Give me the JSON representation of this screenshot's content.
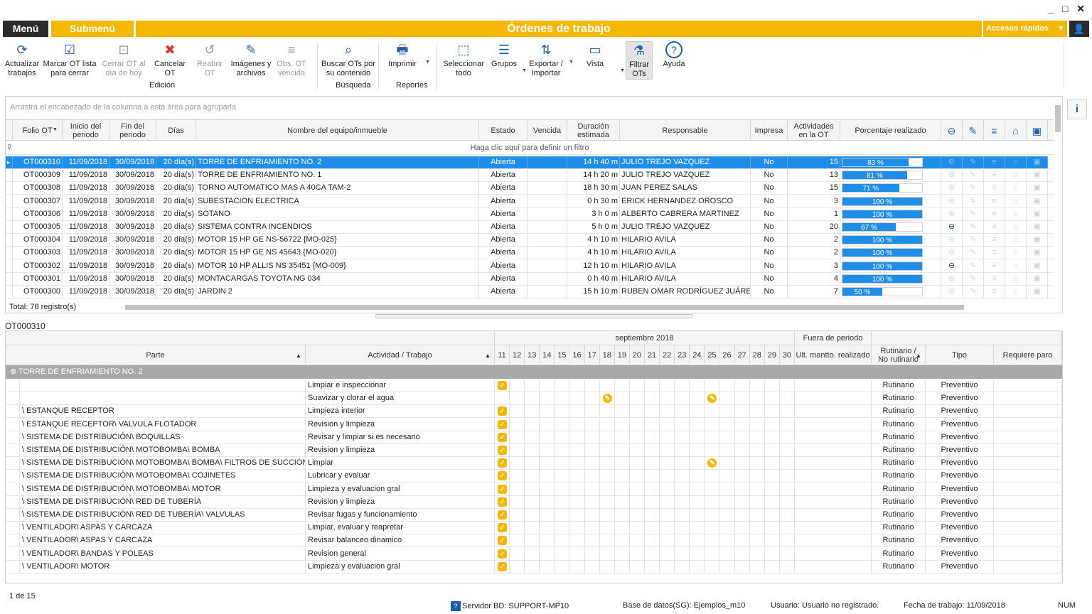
{
  "window": {
    "controls": "_ □ ✕"
  },
  "top": {
    "menu": "Menú",
    "submenu": "Submenú",
    "title": "Órdenes de trabajo",
    "quick": "Accesos rápidos"
  },
  "ribbon": {
    "buttons": [
      {
        "label": "Actualizar\ntrabajos",
        "icon": "refresh-ot-icon"
      },
      {
        "label": "Marcar OT lista\npara cerrar",
        "icon": "mark-ot-icon"
      },
      {
        "label": "Cerrar OT al\ndía de hoy",
        "icon": "close-ot-icon"
      },
      {
        "label": "Cancelar\nOT",
        "icon": "cancel-ot-icon"
      },
      {
        "label": "Reabrir\nOT",
        "icon": "reopen-ot-icon"
      },
      {
        "label": "Imágenes y\narchivos",
        "icon": "images-icon"
      },
      {
        "label": "Obs. OT\nvencida",
        "icon": "obs-icon"
      },
      {
        "label": "Buscar OTs por\nsu contenido",
        "icon": "search-ot-icon"
      },
      {
        "label": "Imprimir",
        "icon": "print-icon"
      },
      {
        "label": "Seleccionar\ntodo",
        "icon": "select-all-icon"
      },
      {
        "label": "Grupos",
        "icon": "groups-icon"
      },
      {
        "label": "Exportar /\nImportar",
        "icon": "export-icon"
      },
      {
        "label": "Vista",
        "icon": "view-icon"
      },
      {
        "label": "Filtrar\nOTs",
        "icon": "filter-icon"
      },
      {
        "label": "Ayuda",
        "icon": "help-icon"
      }
    ],
    "groups": {
      "edicion": "Edición",
      "busqueda": "Búsqueda",
      "reportes": "Reportes"
    }
  },
  "grid1": {
    "group_hint": "Arrastra el encabezado de la columna a esta área para agruparla",
    "filter_hint": "Haga clic aquí para definir un filtro",
    "columns": [
      "Folio OT",
      "Inicio del\nperiodo",
      "Fin del\nperiodo",
      "Días",
      "Nombre del equipo/inmueble",
      "Estado",
      "Vencida",
      "Duración\nestimada",
      "Responsable",
      "Impresa",
      "Actividades\nen la OT",
      "Porcentaje realizado"
    ],
    "rows": [
      {
        "folio": "OT000310",
        "inicio": "11/09/2018",
        "fin": "30/09/2018",
        "dias": "20 día(s)",
        "nombre": "TORRE DE ENFRIAMIENTO NO. 2",
        "estado": "Abierta",
        "vencida": "",
        "duracion": "14 h 40 m",
        "resp": "JULIO TREJO VAZQUEZ",
        "impresa": "No",
        "act": "15",
        "pct": 83,
        "pct_label": "83 %",
        "minus": false
      },
      {
        "folio": "OT000309",
        "inicio": "11/09/2018",
        "fin": "30/09/2018",
        "dias": "20 día(s)",
        "nombre": "TORRE DE ENFRIAMIENTO NO. 1",
        "estado": "Abierta",
        "vencida": "",
        "duracion": "14 h 20 m",
        "resp": "JULIO TREJO VAZQUEZ",
        "impresa": "No",
        "act": "13",
        "pct": 81,
        "pct_label": "81 %",
        "minus": false
      },
      {
        "folio": "OT000308",
        "inicio": "11/09/2018",
        "fin": "30/09/2018",
        "dias": "20 día(s)",
        "nombre": "TORNO AUTOMATICO MAS A 40CA TAM-2",
        "estado": "Abierta",
        "vencida": "",
        "duracion": "18 h 30 m",
        "resp": "JUAN PEREZ SALAS",
        "impresa": "No",
        "act": "15",
        "pct": 71,
        "pct_label": "71 %",
        "minus": false
      },
      {
        "folio": "OT000307",
        "inicio": "11/09/2018",
        "fin": "30/09/2018",
        "dias": "20 día(s)",
        "nombre": "SUBESTACION ELECTRICA",
        "estado": "Abierta",
        "vencida": "",
        "duracion": "0 h 30 m",
        "resp": "ERICK HERNANDEZ OROSCO",
        "impresa": "No",
        "act": "3",
        "pct": 100,
        "pct_label": "100 %",
        "minus": false
      },
      {
        "folio": "OT000306",
        "inicio": "11/09/2018",
        "fin": "30/09/2018",
        "dias": "20 día(s)",
        "nombre": "SOTANO",
        "estado": "Abierta",
        "vencida": "",
        "duracion": "3 h 0 m",
        "resp": "ALBERTO CABRERA MARTINEZ",
        "impresa": "No",
        "act": "1",
        "pct": 100,
        "pct_label": "100 %",
        "minus": false
      },
      {
        "folio": "OT000305",
        "inicio": "11/09/2018",
        "fin": "30/09/2018",
        "dias": "20 día(s)",
        "nombre": "SISTEMA CONTRA INCENDIOS",
        "estado": "Abierta",
        "vencida": "",
        "duracion": "5 h 0 m",
        "resp": "JULIO TREJO VAZQUEZ",
        "impresa": "No",
        "act": "20",
        "pct": 67,
        "pct_label": "67 %",
        "minus": true
      },
      {
        "folio": "OT000304",
        "inicio": "11/09/2018",
        "fin": "30/09/2018",
        "dias": "20 día(s)",
        "nombre": "MOTOR 15 HP GE NS-56722 {MO-025}",
        "estado": "Abierta",
        "vencida": "",
        "duracion": "4 h 10 m",
        "resp": "HILARIO AVILA",
        "impresa": "No",
        "act": "2",
        "pct": 100,
        "pct_label": "100 %",
        "minus": false
      },
      {
        "folio": "OT000303",
        "inicio": "11/09/2018",
        "fin": "30/09/2018",
        "dias": "20 día(s)",
        "nombre": "MOTOR 15 HP GE NS 45643 {MO-020}",
        "estado": "Abierta",
        "vencida": "",
        "duracion": "4 h 10 m",
        "resp": "HILARIO AVILA",
        "impresa": "No",
        "act": "2",
        "pct": 100,
        "pct_label": "100 %",
        "minus": false
      },
      {
        "folio": "OT000302",
        "inicio": "11/09/2018",
        "fin": "30/09/2018",
        "dias": "20 día(s)",
        "nombre": "MOTOR 10 HP ALLIS NS 35451 {MO-009}",
        "estado": "Abierta",
        "vencida": "",
        "duracion": "12 h 10 m",
        "resp": "HILARIO AVILA",
        "impresa": "No",
        "act": "3",
        "pct": 100,
        "pct_label": "100 %",
        "minus": true
      },
      {
        "folio": "OT000301",
        "inicio": "11/09/2018",
        "fin": "30/09/2018",
        "dias": "20 día(s)",
        "nombre": "MONTACARGAS TOYOTA NG 034",
        "estado": "Abierta",
        "vencida": "",
        "duracion": "0 h 40 m",
        "resp": "HILARIO AVILA",
        "impresa": "No",
        "act": "4",
        "pct": 100,
        "pct_label": "100 %",
        "minus": false
      },
      {
        "folio": "OT000300",
        "inicio": "11/09/2018",
        "fin": "30/09/2018",
        "dias": "20 día(s)",
        "nombre": "JARDIN 2",
        "estado": "Abierta",
        "vencida": "",
        "duracion": "15 h 10 m",
        "resp": "RUBEN OMAR RODRÍGUEZ JUÁREZ",
        "impresa": "No",
        "act": "7",
        "pct": 50,
        "pct_label": "50 %",
        "minus": false
      }
    ],
    "total": "Total: 78 registro(s)"
  },
  "detail": {
    "ot": "OT000310",
    "month": "septiembre 2018",
    "fuera": "Fuera de periodo",
    "col_parte": "Parte",
    "col_actividad": "Actividad / Trabajo",
    "days": [
      "11",
      "12",
      "13",
      "14",
      "15",
      "16",
      "17",
      "18",
      "19",
      "20",
      "21",
      "22",
      "23",
      "24",
      "25",
      "26",
      "27",
      "28",
      "29",
      "30"
    ],
    "col_ult": "Ult. mantto. realizado",
    "col_rut": "Rutinario /\nNo rutinario",
    "col_tipo": "Tipo",
    "col_paro": "Requiere paro",
    "group": "TORRE DE ENFRIAMIENTO NO. 2",
    "rows": [
      {
        "parte": "",
        "act": "Limpiar e inspeccionar",
        "rut": "Rutinario",
        "tipo": "Preventivo",
        "marks": [
          0
        ]
      },
      {
        "parte": "",
        "act": "Suavizar y clorar el agua",
        "rut": "Rutinario",
        "tipo": "Preventivo",
        "marks": [
          7,
          14
        ],
        "pend": true
      },
      {
        "parte": "\\ ESTANQUE RECEPTOR",
        "act": "Limpieza interior",
        "rut": "Rutinario",
        "tipo": "Preventivo",
        "marks": [
          0
        ]
      },
      {
        "parte": "\\ ESTANQUE RECEPTOR\\ VALVULA FLOTADOR",
        "act": "Revision y limpieza",
        "rut": "Rutinario",
        "tipo": "Preventivo",
        "marks": [
          0
        ]
      },
      {
        "parte": "\\ SISTEMA DE DISTRIBUCIÓN\\ BOQUILLAS",
        "act": "Revisar y limpiar si es necesario",
        "rut": "Rutinario",
        "tipo": "Preventivo",
        "marks": [
          0
        ]
      },
      {
        "parte": "\\ SISTEMA DE DISTRIBUCIÓN\\ MOTOBOMBA\\ BOMBA",
        "act": "Revision y limpieza",
        "rut": "Rutinario",
        "tipo": "Preventivo",
        "marks": [
          0
        ]
      },
      {
        "parte": "\\ SISTEMA DE DISTRIBUCIÓN\\ MOTOBOMBA\\ BOMBA\\ FILTROS DE SUCCIÓN",
        "act": "Limpiar",
        "rut": "Rutinario",
        "tipo": "Preventivo",
        "marks": [
          0,
          14
        ],
        "pend2": true
      },
      {
        "parte": "\\ SISTEMA DE DISTRIBUCIÓN\\ MOTOBOMBA\\ COJINETES",
        "act": "Lubricar y evaluar",
        "rut": "Rutinario",
        "tipo": "Preventivo",
        "marks": [
          0
        ]
      },
      {
        "parte": "\\ SISTEMA DE DISTRIBUCIÓN\\ MOTOBOMBA\\ MOTOR",
        "act": "Limpieza y evaluacion gral",
        "rut": "Rutinario",
        "tipo": "Preventivo",
        "marks": [
          0
        ]
      },
      {
        "parte": "\\ SISTEMA DE DISTRIBUCIÓN\\ RED DE TUBERÍA",
        "act": "Revision y limpieza",
        "rut": "Rutinario",
        "tipo": "Preventivo",
        "marks": [
          0
        ]
      },
      {
        "parte": "\\ SISTEMA DE DISTRIBUCIÓN\\ RED DE TUBERÍA\\ VALVULAS",
        "act": "Revisar fugas y funcionamiento",
        "rut": "Rutinario",
        "tipo": "Preventivo",
        "marks": [
          0
        ]
      },
      {
        "parte": "\\ VENTILADOR\\ ASPAS Y CARCAZA",
        "act": "Limpiar, evaluar y reapretar",
        "rut": "Rutinario",
        "tipo": "Preventivo",
        "marks": [
          0
        ]
      },
      {
        "parte": "\\ VENTILADOR\\ ASPAS Y CARCAZA",
        "act": "Revisar balanceo dinamico",
        "rut": "Rutinario",
        "tipo": "Preventivo",
        "marks": [
          0
        ]
      },
      {
        "parte": "\\ VENTILADOR\\ BANDAS Y POLEAS",
        "act": "Revision general",
        "rut": "Rutinario",
        "tipo": "Preventivo",
        "marks": [
          0
        ]
      },
      {
        "parte": "\\ VENTILADOR\\ MOTOR",
        "act": "Limpieza y evaluacion gral",
        "rut": "Rutinario",
        "tipo": "Preventivo",
        "marks": [
          0
        ]
      }
    ],
    "pager": "1 de 15"
  },
  "status": {
    "server": "Servidor BD: SUPPORT-MP10",
    "db": "Base de datos(SG): Ejemplos_m10",
    "user": "Usuario: Usuario no registrado.",
    "date": "Fecha de trabajo: 11/09/2018",
    "num": "NUM"
  },
  "colors": {
    "accent": "#f5b800",
    "selection": "#1f8ee8",
    "dark": "#2b2b2b"
  }
}
